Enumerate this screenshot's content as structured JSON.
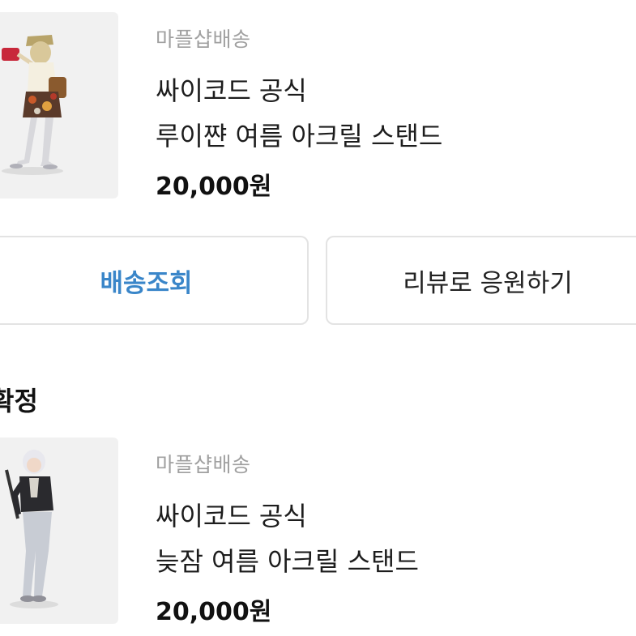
{
  "orders": [
    {
      "seller": "마플샵배송",
      "shop": "싸이코드 공식",
      "title": "루이쨘 여름 아크릴 스탠드",
      "price": "20,000원",
      "image": "acrylic-stand-figure-1"
    },
    {
      "seller": "마플샵배송",
      "shop": "싸이코드 공식",
      "title": "늦잠 여름 아크릴 스탠드",
      "price": "20,000원",
      "image": "acrylic-stand-figure-2"
    }
  ],
  "actions": {
    "track_label": "배송조회",
    "review_label": "리뷰로 응원하기",
    "track_color": "#3a86c9"
  },
  "section": {
    "label": "확정"
  }
}
